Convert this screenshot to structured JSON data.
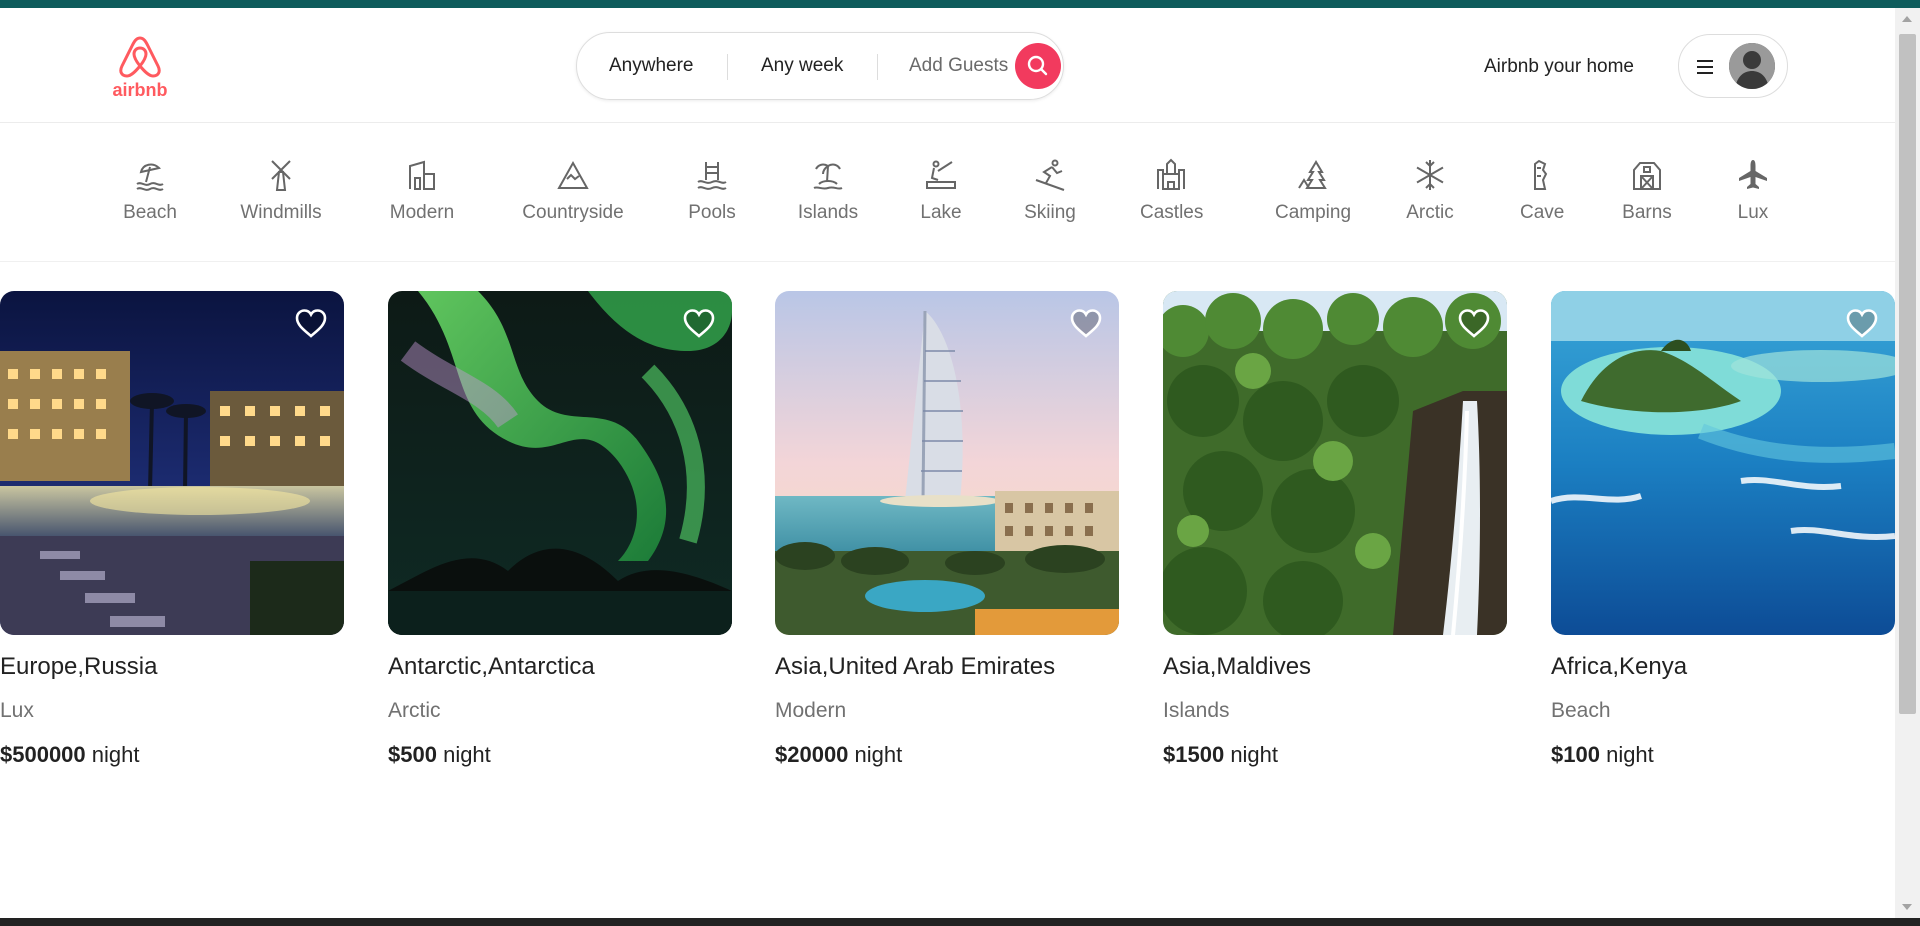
{
  "colors": {
    "brand": "#ff5a5f",
    "search_button": "#f23a5e",
    "top_accent": "#0e5c5c"
  },
  "header": {
    "logo_text": "airbnb",
    "search": {
      "where": "Anywhere",
      "when": "Any week",
      "guests": "Add Guests"
    },
    "host_link": "Airbnb your home"
  },
  "categories": [
    {
      "label": "Beach",
      "icon": "beach-icon"
    },
    {
      "label": "Windmills",
      "icon": "windmill-icon"
    },
    {
      "label": "Modern",
      "icon": "modern-house-icon"
    },
    {
      "label": "Countryside",
      "icon": "mountain-icon"
    },
    {
      "label": "Pools",
      "icon": "pool-icon"
    },
    {
      "label": "Islands",
      "icon": "island-icon"
    },
    {
      "label": "Lake",
      "icon": "lake-icon"
    },
    {
      "label": "Skiing",
      "icon": "skiing-icon"
    },
    {
      "label": "Castles",
      "icon": "castle-icon"
    },
    {
      "label": "Camping",
      "icon": "camping-icon"
    },
    {
      "label": "Arctic",
      "icon": "snowflake-icon"
    },
    {
      "label": "Cave",
      "icon": "cave-icon"
    },
    {
      "label": "Barns",
      "icon": "barn-icon"
    },
    {
      "label": "Lux",
      "icon": "airplane-icon"
    }
  ],
  "listings": [
    {
      "title": "Europe,Russia",
      "category": "Lux",
      "price": "$500000",
      "unit": "night"
    },
    {
      "title": "Antarctic,Antarctica",
      "category": "Arctic",
      "price": "$500",
      "unit": "night"
    },
    {
      "title": "Asia,United Arab Emirates",
      "category": "Modern",
      "price": "$20000",
      "unit": "night"
    },
    {
      "title": "Asia,Maldives",
      "category": "Islands",
      "price": "$1500",
      "unit": "night"
    },
    {
      "title": "Africa,Kenya",
      "category": "Beach",
      "price": "$100",
      "unit": "night"
    }
  ]
}
